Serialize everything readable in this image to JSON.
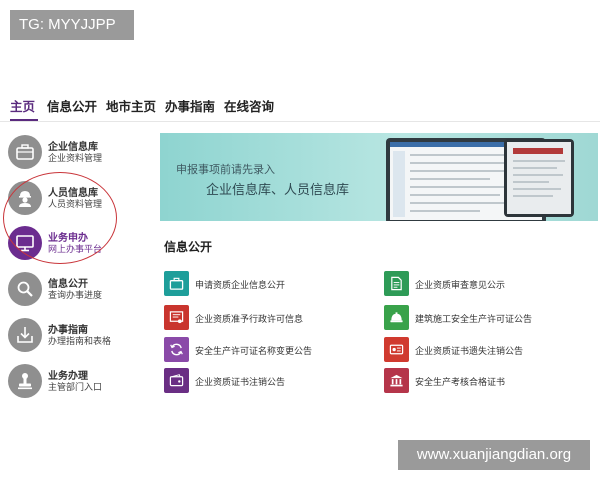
{
  "watermarks": {
    "top": "TG: MYYJJPP",
    "bottom": "www.xuanjiangdian.org"
  },
  "nav": {
    "items": [
      {
        "label": "主页",
        "active": true
      },
      {
        "label": "信息公开"
      },
      {
        "label": "地市主页"
      },
      {
        "label": "办事指南"
      },
      {
        "label": "在线咨询"
      }
    ]
  },
  "sidebar": {
    "items": [
      {
        "title": "企业信息库",
        "subtitle": "企业资料管理",
        "icon": "briefcase-icon"
      },
      {
        "title": "人员信息库",
        "subtitle": "人员资料管理",
        "icon": "worker-icon"
      },
      {
        "title": "业务申办",
        "subtitle": "网上办事平台",
        "icon": "monitor-icon",
        "highlighted": true
      },
      {
        "title": "信息公开",
        "subtitle": "查询办事进度",
        "icon": "search-icon"
      },
      {
        "title": "办事指南",
        "subtitle": "办理指南和表格",
        "icon": "download-icon"
      },
      {
        "title": "业务办理",
        "subtitle": "主管部门入口",
        "icon": "stamp-icon"
      }
    ]
  },
  "banner": {
    "line1": "申报事项前请先录入",
    "line2": "企业信息库、人员信息库"
  },
  "info": {
    "title": "信息公开",
    "items": [
      {
        "label": "申请资质企业信息公开",
        "icon": "briefcase-icon",
        "color": "#1e9e9a"
      },
      {
        "label": "企业资质审查意见公示",
        "icon": "document-icon",
        "color": "#2e9b57"
      },
      {
        "label": "企业资质准予行政许可信息",
        "icon": "certificate-icon",
        "color": "#c9352e"
      },
      {
        "label": "建筑施工安全生产许可证公告",
        "icon": "helmet-icon",
        "color": "#39a24a"
      },
      {
        "label": "安全生产许可证名称变更公告",
        "icon": "refresh-icon",
        "color": "#8a4aa8"
      },
      {
        "label": "企业资质证书遗失注销公告",
        "icon": "card-icon",
        "color": "#d03a2f"
      },
      {
        "label": "企业资质证书注销公告",
        "icon": "wallet-icon",
        "color": "#6a2e84"
      },
      {
        "label": "安全生产考核合格证书",
        "icon": "bank-icon",
        "color": "#b5354a"
      }
    ]
  }
}
